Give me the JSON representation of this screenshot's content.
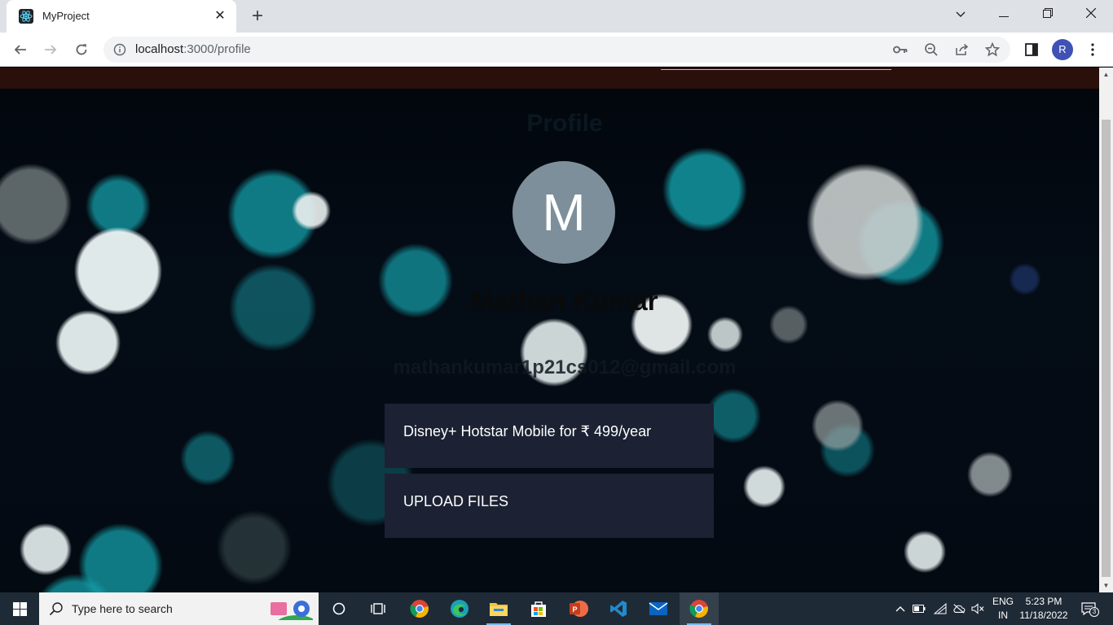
{
  "browser": {
    "tab_title": "MyProject",
    "url_host": "localhost",
    "url_path": ":3000/profile",
    "profile_initial": "R"
  },
  "page": {
    "heading": "Profile",
    "avatar_letter": "M",
    "name": "Mathan Kumar",
    "email": "mathankumar1p21cs012@gmail.com",
    "cards": [
      {
        "label": "Disney+ Hotstar Mobile for ₹ 499/year"
      },
      {
        "label": "UPLOAD FILES"
      }
    ]
  },
  "taskbar": {
    "search_placeholder": "Type here to search",
    "language_top": "ENG",
    "language_bottom": "IN",
    "time": "5:23 PM",
    "date": "11/18/2022",
    "notification_count": "3"
  },
  "colors": {
    "card_bg": "#1c2233",
    "topbar_bg": "#2a0f0a",
    "avatar_bg": "#7d8f9a",
    "taskbar_bg": "#1f2a37"
  }
}
